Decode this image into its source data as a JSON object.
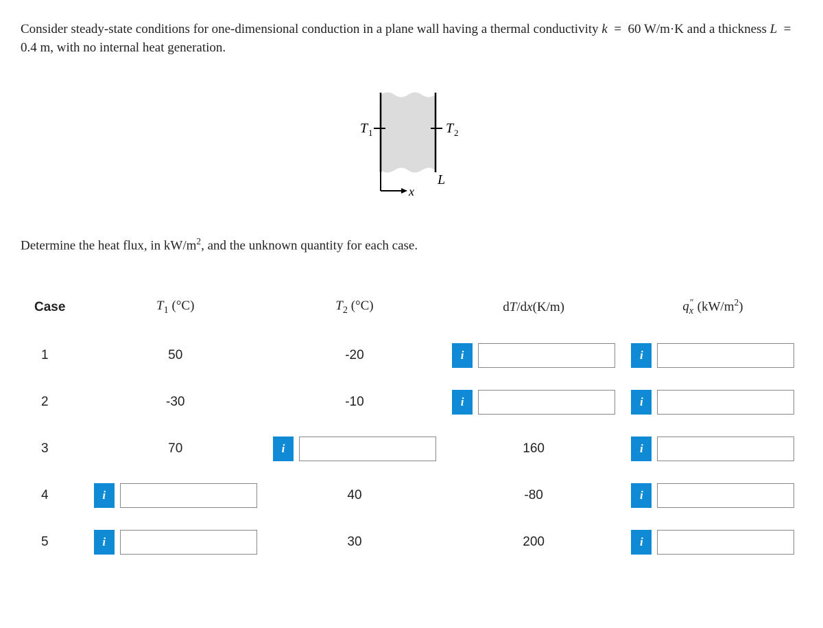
{
  "problem_para": "Consider steady-state conditions for one-dimensional conduction in a plane wall having a thermal conductivity k  =  60 W/m·K and a thickness L  =  0.4 m, with no internal heat generation.",
  "diagram": {
    "T1": "T",
    "T1_sub": "1",
    "T2": "T",
    "T2_sub": "2",
    "x": "x",
    "L": "L"
  },
  "followup_html": "Determine the heat flux, in kW/m², and the unknown quantity for each case.",
  "info_label": "i",
  "table": {
    "headers": {
      "case": "Case",
      "T1": "T₁ (°C)",
      "T2": "T₂ (°C)",
      "dTdx": "dT/dx(K/m)",
      "qx": "q″ₓ (kW/m²)"
    },
    "rows": [
      {
        "case": "1",
        "T1": "50",
        "T2": "-20",
        "dTdx": "",
        "qx": "",
        "T1_input": false,
        "T2_input": false,
        "dTdx_input": true,
        "qx_input": true
      },
      {
        "case": "2",
        "T1": "-30",
        "T2": "-10",
        "dTdx": "",
        "qx": "",
        "T1_input": false,
        "T2_input": false,
        "dTdx_input": true,
        "qx_input": true
      },
      {
        "case": "3",
        "T1": "70",
        "T2": "",
        "dTdx": "160",
        "qx": "",
        "T1_input": false,
        "T2_input": true,
        "dTdx_input": false,
        "qx_input": true
      },
      {
        "case": "4",
        "T1": "",
        "T2": "40",
        "dTdx": "-80",
        "qx": "",
        "T1_input": true,
        "T2_input": false,
        "dTdx_input": false,
        "qx_input": true
      },
      {
        "case": "5",
        "T1": "",
        "T2": "30",
        "dTdx": "200",
        "qx": "",
        "T1_input": true,
        "T2_input": false,
        "dTdx_input": false,
        "qx_input": true
      }
    ]
  }
}
